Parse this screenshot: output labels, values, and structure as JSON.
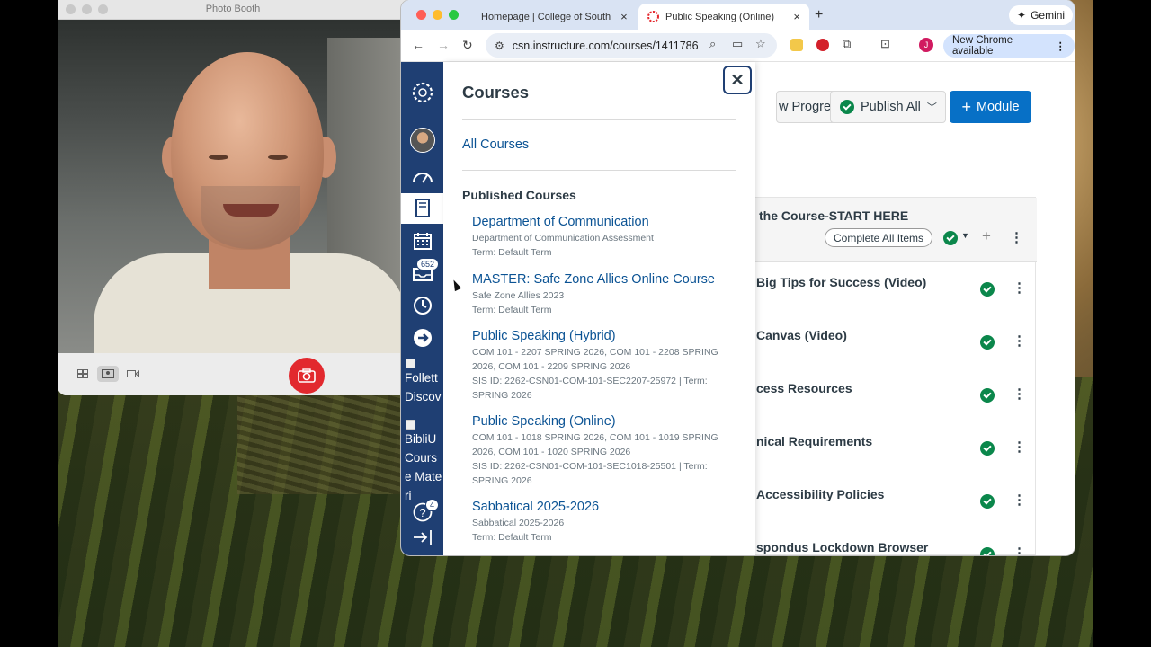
{
  "photo_booth": {
    "title": "Photo Booth",
    "modes": [
      "grid-icon",
      "single-photo-icon",
      "video-icon"
    ]
  },
  "chrome": {
    "tabs": [
      {
        "label": "Homepage | College of South",
        "active": false
      },
      {
        "label": "Public Speaking (Online)",
        "active": true
      }
    ],
    "gemini_label": "Gemini",
    "url": "csn.instructure.com/courses/1411786",
    "new_chrome_label": "New Chrome available",
    "profile_initial": "J"
  },
  "global_nav": {
    "inbox_badge": "652",
    "help_badge": "4",
    "follett_alt": "Follett Discov",
    "bibliu_alt": "BibliU Course Materi"
  },
  "tray": {
    "title": "Courses",
    "all_courses": "All Courses",
    "published_heading": "Published Courses",
    "courses": [
      {
        "name": "Department of Communication",
        "meta": [
          "Department of Communication Assessment",
          "Term: Default Term"
        ]
      },
      {
        "name": "MASTER: Safe Zone Allies Online Course",
        "meta": [
          "Safe Zone Allies 2023",
          "Term: Default Term"
        ]
      },
      {
        "name": "Public Speaking (Hybrid)",
        "meta": [
          "COM 101 - 2207 SPRING 2026, COM 101 - 2208 SPRING",
          "2026, COM 101 - 2209 SPRING 2026",
          "SIS ID: 2262-CSN01-COM-101-SEC2207-25972 | Term:",
          "SPRING 2026"
        ]
      },
      {
        "name": "Public Speaking (Online)",
        "meta": [
          "COM 101 - 1018 SPRING 2026, COM 101 - 1019 SPRING",
          "2026, COM 101 - 1020 SPRING 2026",
          "SIS ID: 2262-CSN01-COM-101-SEC1018-25501 | Term:",
          "SPRING 2026"
        ]
      },
      {
        "name": "Sabbatical 2025-2026",
        "meta": [
          "Sabbatical 2025-2026",
          "Term: Default Term"
        ]
      }
    ]
  },
  "course_page": {
    "view_progress": "w Progress",
    "publish_all": "Publish All",
    "add_module": "Module",
    "module_title": "the Course-START HERE",
    "complete_all": "Complete All Items",
    "items": [
      "Big Tips for Success (Video)",
      "Canvas (Video)",
      "cess Resources",
      "nical Requirements",
      "Accessibility Policies",
      "spondus Lockdown Browser"
    ]
  },
  "colors": {
    "canvas_nav": "#1f3f73",
    "link": "#0b5394",
    "primary_button": "#0770c6",
    "success": "#0b874b",
    "shutter": "#e2292e"
  }
}
